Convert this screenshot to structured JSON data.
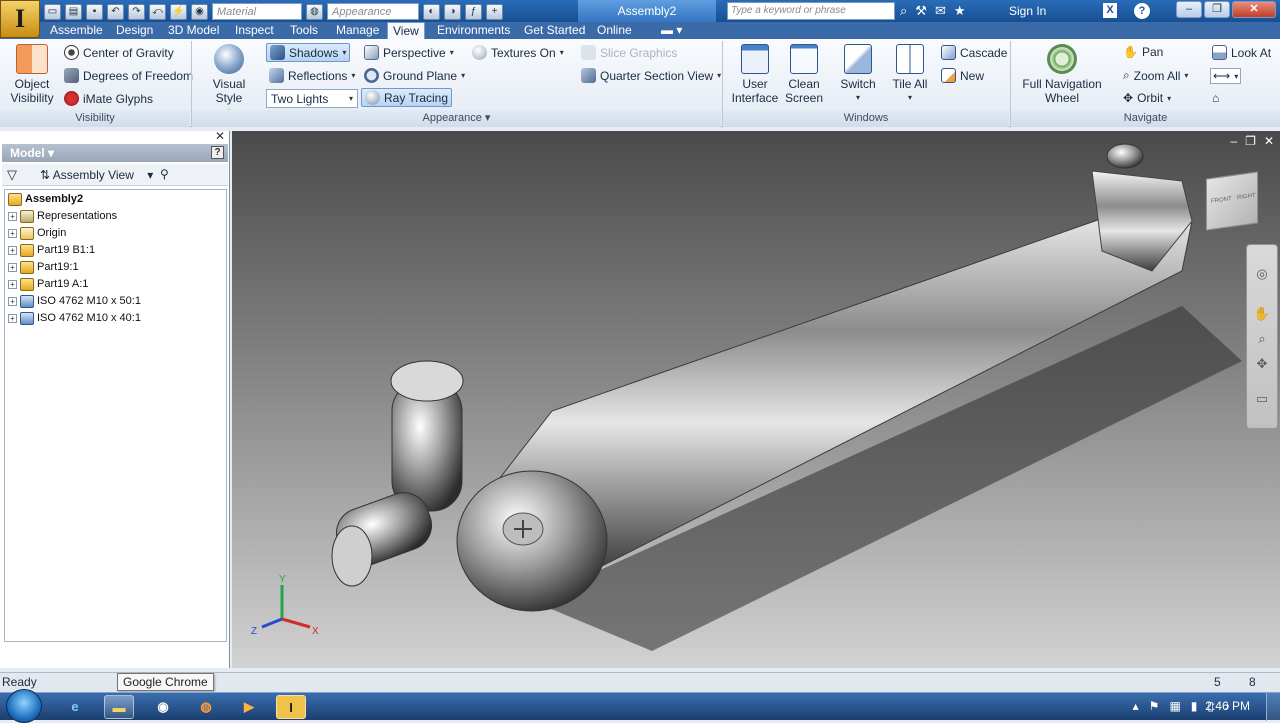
{
  "app": {
    "logo": "I",
    "doc_title": "Assembly2"
  },
  "quick_access": {
    "material": "Material",
    "appearance": "Appearance"
  },
  "titlebar": {
    "search_placeholder": "Type a keyword or phrase",
    "sign_in": "Sign In",
    "help": "?",
    "exchange": "X"
  },
  "tabs": [
    {
      "label": "Assemble"
    },
    {
      "label": "Design"
    },
    {
      "label": "3D Model"
    },
    {
      "label": "Inspect"
    },
    {
      "label": "Tools"
    },
    {
      "label": "Manage"
    },
    {
      "label": "View"
    },
    {
      "label": "Environments"
    },
    {
      "label": "Get Started"
    },
    {
      "label": "Online"
    }
  ],
  "ribbon": {
    "visibility": {
      "title": "Visibility",
      "object_visibility": "Object Visibility",
      "center_of_gravity": "Center of Gravity",
      "degrees_of_freedom": "Degrees of Freedom",
      "imate_glyphs": "iMate Glyphs"
    },
    "appearance": {
      "title": "Appearance",
      "visual_style": "Visual Style",
      "shadows": "Shadows",
      "reflections": "Reflections",
      "two_lights": "Two Lights",
      "perspective": "Perspective",
      "ground_plane": "Ground Plane",
      "ray_tracing": "Ray Tracing",
      "textures_on": "Textures On",
      "slice_graphics": "Slice Graphics",
      "quarter_section_view": "Quarter Section View"
    },
    "windows": {
      "title": "Windows",
      "user_interface": "User Interface",
      "clean_screen": "Clean Screen",
      "switch": "Switch",
      "tile_all": "Tile All",
      "cascade": "Cascade",
      "new": "New"
    },
    "navigate": {
      "title": "Navigate",
      "full_navigation_wheel": "Full Navigation Wheel",
      "pan": "Pan",
      "zoom_all": "Zoom All",
      "orbit": "Orbit",
      "look_at": "Look At"
    }
  },
  "browser": {
    "header": "Model",
    "view": "Assembly View",
    "root": "Assembly2",
    "items": [
      {
        "label": "Representations"
      },
      {
        "label": "Origin"
      },
      {
        "label": "Part19 B1:1"
      },
      {
        "label": "Part19:1"
      },
      {
        "label": "Part19 A:1"
      },
      {
        "label": "ISO 4762 M10 x 50:1"
      },
      {
        "label": "ISO 4762 M10 x 40:1"
      }
    ]
  },
  "triad": {
    "x": "X",
    "y": "Y",
    "z": "Z"
  },
  "viewcube": {
    "front": "FRONT",
    "right": "RIGHT"
  },
  "status": {
    "text": "Ready",
    "count1": "5",
    "count2": "8"
  },
  "tooltip": "Google Chrome",
  "taskbar": {
    "time": "2:46 PM"
  }
}
